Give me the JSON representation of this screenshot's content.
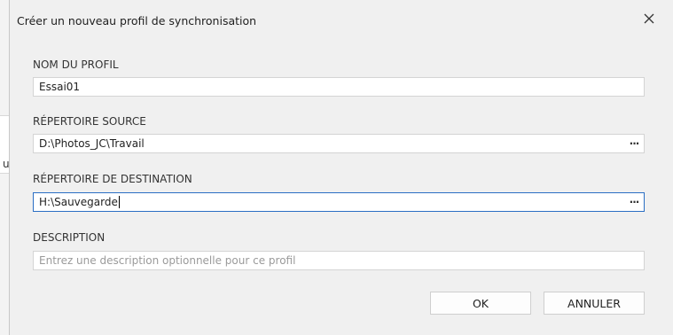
{
  "background": {
    "partial_char": "u"
  },
  "dialog": {
    "title": "Créer un nouveau profil de synchronisation",
    "close_icon": "close-icon"
  },
  "form": {
    "profile_name": {
      "label": "NOM DU PROFIL",
      "value": "Essai01"
    },
    "source_dir": {
      "label": "RÉPERTOIRE SOURCE",
      "value": "D:\\Photos_JC\\Travail",
      "browse": "···"
    },
    "dest_dir": {
      "label": "RÉPERTOIRE DE DESTINATION",
      "value": "H:\\Sauvegarde",
      "browse": "···"
    },
    "description": {
      "label": "DESCRIPTION",
      "placeholder": "Entrez une description optionnelle pour ce profil"
    }
  },
  "buttons": {
    "ok": "OK",
    "cancel": "ANNULER"
  },
  "colors": {
    "focus_border": "#2a6ec4",
    "background": "#f0f0f0"
  }
}
